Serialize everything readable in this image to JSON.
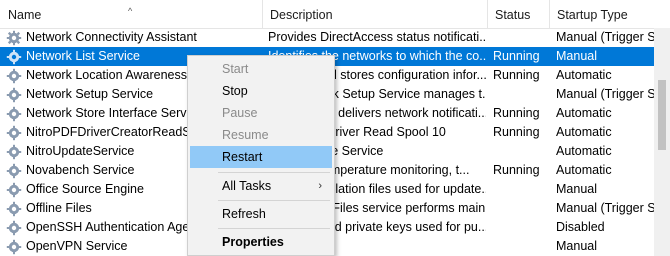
{
  "columns": {
    "name": "Name",
    "description": "Description",
    "status": "Status",
    "startup_type": "Startup Type"
  },
  "sort_indicator": "^",
  "rows": [
    {
      "name": "Network Connectivity Assistant",
      "description": "Provides DirectAccess status notificati...",
      "status": "",
      "startup": "Manual (Trigger St"
    },
    {
      "name": "Network List Service",
      "description": "Identifies the networks to which the co...",
      "status": "Running",
      "startup": "Manual",
      "selected": true
    },
    {
      "name": "Network Location Awareness",
      "description": "Collects and stores configuration infor...",
      "status": "Running",
      "startup": "Automatic"
    },
    {
      "name": "Network Setup Service",
      "description": "The Network Setup Service manages t...",
      "status": "",
      "startup": "Manual (Trigger St"
    },
    {
      "name": "Network Store Interface Service",
      "description": "This service delivers network notificati...",
      "status": "Running",
      "startup": "Automatic"
    },
    {
      "name": "NitroPDFDriverCreatorReadSpool",
      "description": "Nitro PDF Driver Read Spool 10",
      "status": "Running",
      "startup": "Automatic"
    },
    {
      "name": "NitroUpdateService",
      "description": "Nitro Update Service",
      "status": "",
      "startup": "Automatic"
    },
    {
      "name": "Novabench Service",
      "description": "Monitors temperature monitoring, t...",
      "status": "Running",
      "startup": "Automatic"
    },
    {
      "name": "Office  Source Engine",
      "description": "Saves installation files used for update...",
      "status": "",
      "startup": "Manual"
    },
    {
      "name": "Offline Files",
      "description": "The Offline Files service performs main...",
      "status": "",
      "startup": "Manual (Trigger St"
    },
    {
      "name": "OpenSSH Authentication Agent",
      "description": "Agent to hold private keys used for pu...",
      "status": "",
      "startup": "Disabled"
    },
    {
      "name": "OpenVPN Service",
      "description": "",
      "status": "",
      "startup": "Manual"
    }
  ],
  "context_menu": {
    "start": "Start",
    "stop": "Stop",
    "pause": "Pause",
    "resume": "Resume",
    "restart": "Restart",
    "all_tasks": "All Tasks",
    "all_tasks_arrow": "›",
    "refresh": "Refresh",
    "properties": "Properties"
  },
  "colors": {
    "selection": "#0078d7",
    "menu_hover": "#91c9f7",
    "disabled_text": "#8a8a8a"
  }
}
